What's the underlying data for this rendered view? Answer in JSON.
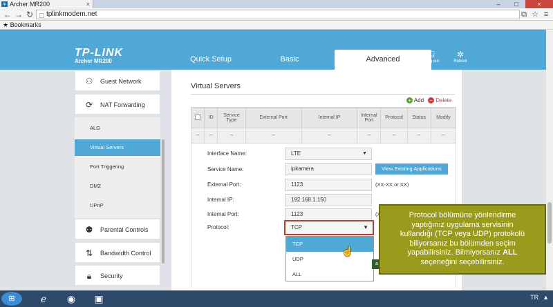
{
  "browser": {
    "tab_title": "Archer MR200",
    "favicon": "tp",
    "url": "tplinkmodem.net",
    "bookmarks_label": "Bookmarks"
  },
  "header": {
    "brand": "TP-LINK",
    "model": "Archer MR200",
    "tabs": [
      "Quick Setup",
      "Basic",
      "Advanced"
    ],
    "logout_label": "Log out",
    "reboot_label": "Reboot"
  },
  "sidebar": {
    "items": [
      {
        "label": "Guest Network",
        "icon": "guest-network-icon"
      },
      {
        "label": "NAT Forwarding",
        "icon": "nat-forwarding-icon"
      },
      {
        "label": "Parental Controls",
        "icon": "parental-controls-icon"
      },
      {
        "label": "Bandwidth Control",
        "icon": "bandwidth-control-icon"
      },
      {
        "label": "Security",
        "icon": "lock-icon"
      }
    ],
    "sub_items": [
      "ALG",
      "Virtual Servers",
      "Port Triggering",
      "DMZ",
      "UPnP"
    ],
    "active_sub_item": "Virtual Servers"
  },
  "main": {
    "title": "Virtual Servers",
    "add_label": "Add",
    "delete_label": "Delete",
    "table": {
      "headers": [
        "ID",
        "Service Type",
        "External Port",
        "Internal IP",
        "Internal Port",
        "Protocol",
        "Status",
        "Modify"
      ],
      "empty_cell": "--"
    },
    "form": {
      "interface_label": "Interface Name:",
      "interface_value": "LTE",
      "service_label": "Service Name:",
      "service_value": "ipkamera",
      "view_button": "View Existing Applications",
      "external_port_label": "External Port:",
      "external_port_value": "1123",
      "external_port_hint": "(XX-XX or XX)",
      "internal_ip_label": "Internal IP:",
      "internal_ip_value": "192.168.1.150",
      "internal_port_label": "Internal Port:",
      "internal_port_value": "1123",
      "internal_port_hint": "(X",
      "protocol_label": "Protocol:",
      "protocol_value": "TCP",
      "protocol_options": [
        "TCP",
        "UDP",
        "ALL"
      ]
    }
  },
  "tooltip": {
    "line1": "Protocol bölümüne yönlendirme",
    "line2": "yaptığınız uygulama servisinin",
    "line3": "kullandığı (TCP veya UDP) protokolü",
    "line4": "biliyorsanız bu bölümden seçim",
    "line5": "yapabilirsiniz. Bilmiyorsanız",
    "line5_bold": "ALL",
    "line6": "seçeneğini seçebilirsiniz."
  },
  "taskbar": {
    "items": [
      "start-orb",
      "ie-icon",
      "chrome-icon",
      "app-icon"
    ],
    "tray_label": "TR"
  },
  "colors": {
    "accent": "#4fa8d6",
    "tooltip_bg": "#9a9a1c",
    "highlight_border": "#c0392b"
  }
}
